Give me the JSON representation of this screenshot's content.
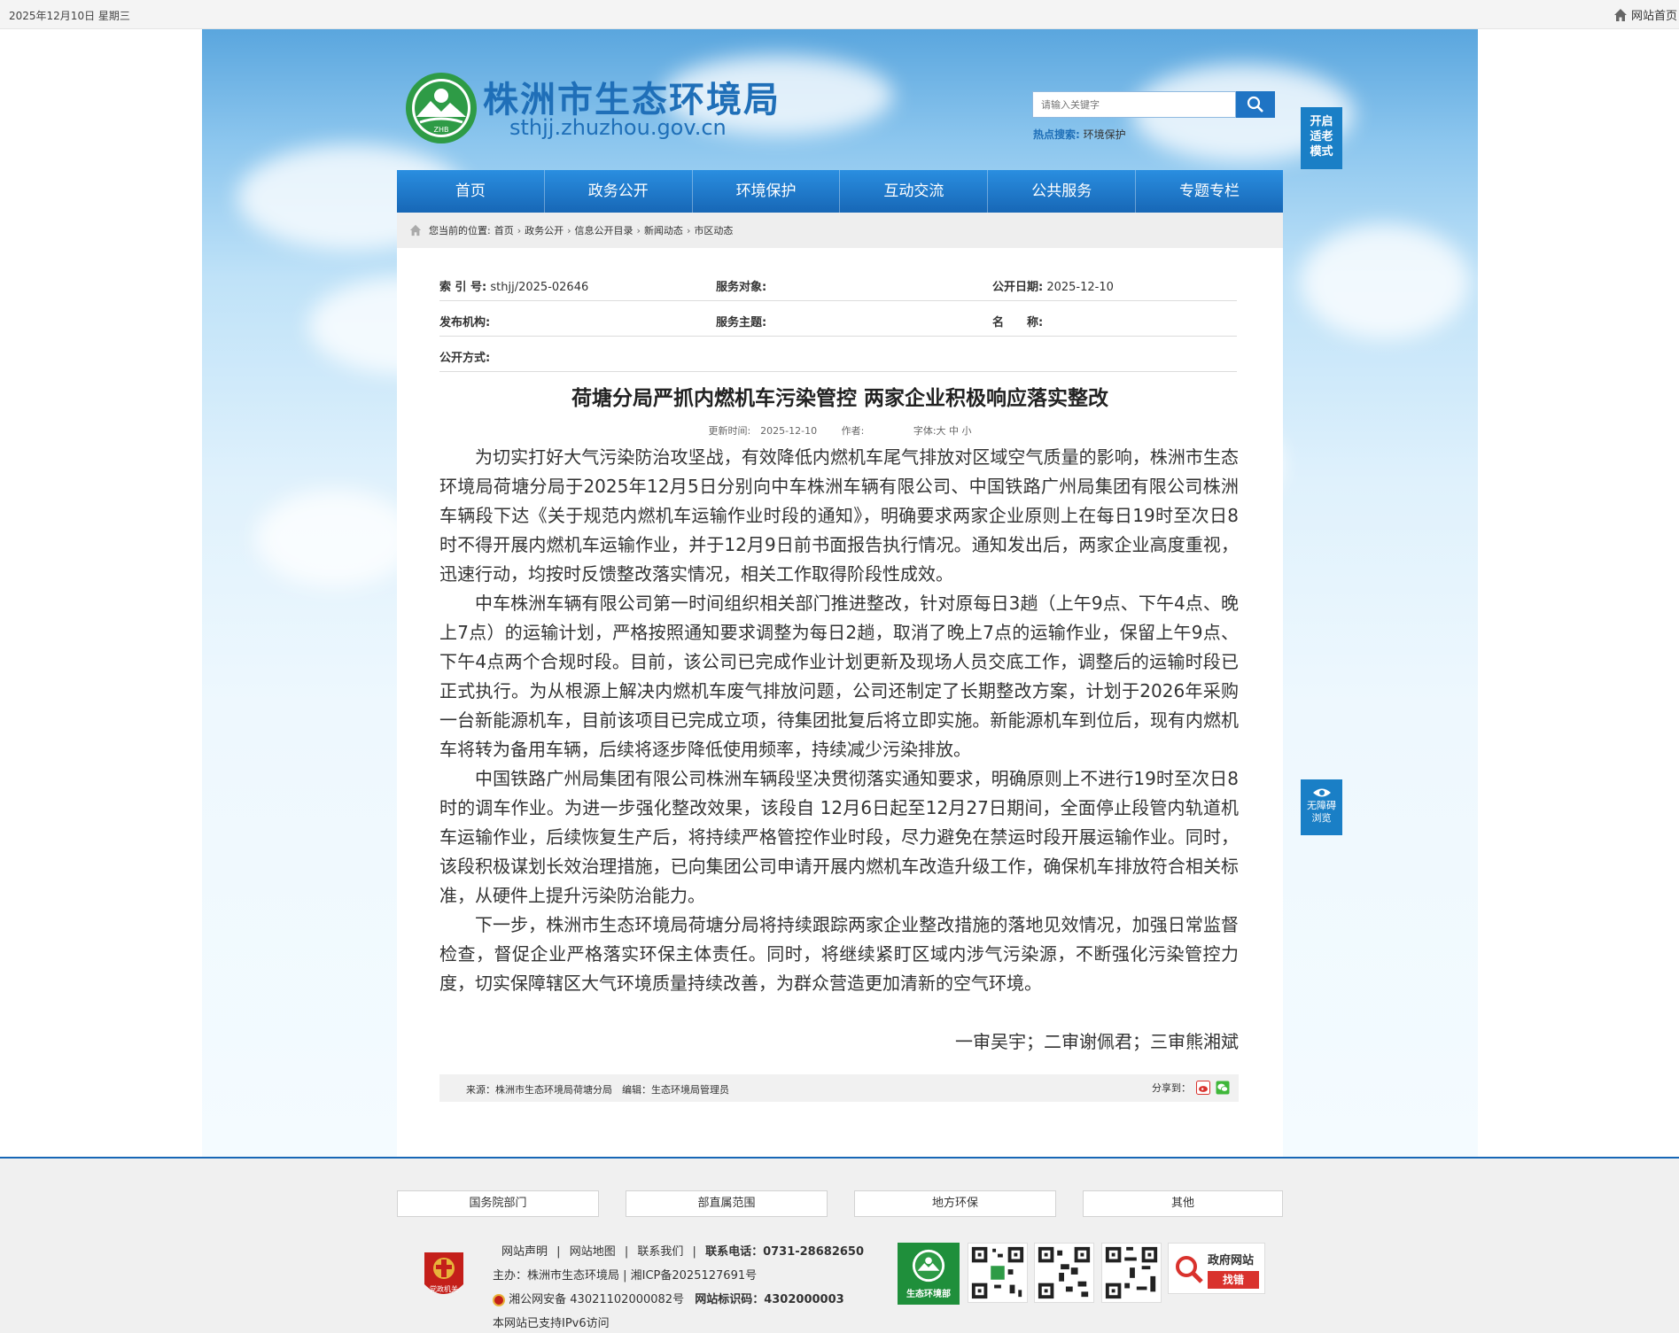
{
  "topbar": {
    "date": "2025年12月10日 星期三",
    "home_label": "网站首页"
  },
  "header": {
    "title": "株洲市生态环境局",
    "domain": "sthjj.zhuzhou.gov.cn",
    "logo_text": "ZHB",
    "search_placeholder": "请输入关键字",
    "hot_label": "热点搜索:",
    "hot_word": "环境保护",
    "elder_mode": [
      "开启",
      "适老",
      "模式"
    ],
    "accessibility": [
      "无障碍",
      "浏览"
    ]
  },
  "nav": [
    "首页",
    "政务公开",
    "环境保护",
    "互动交流",
    "公共服务",
    "专题专栏"
  ],
  "breadcrumb": {
    "prefix": "您当前的位置:",
    "items": [
      "首页",
      "政务公开",
      "信息公开目录",
      "新闻动态",
      "市区动态"
    ]
  },
  "meta": {
    "index_label": "索 引 号:",
    "index_value": "sthjj/2025-02646",
    "target_label": "服务对象:",
    "date_label": "公开日期:",
    "date_value": "2025-12-10",
    "org_label": "发布机构:",
    "topic_label": "服务主题:",
    "name_label": "名　　称:",
    "method_label": "公开方式:"
  },
  "article": {
    "title": "荷塘分局严抓内燃机车污染管控 两家企业积极响应落实整改",
    "updated": "更新时间:　2025-12-10",
    "author": "作者:",
    "fontsize": "字体:大 中 小",
    "paragraphs": [
      "为切实打好大气污染防治攻坚战，有效降低内燃机车尾气排放对区域空气质量的影响，株洲市生态环境局荷塘分局于2025年12月5日分别向中车株洲车辆有限公司、中国铁路广州局集团有限公司株洲车辆段下达《关于规范内燃机车运输作业时段的通知》，明确要求两家企业原则上在每日19时至次日8时不得开展内燃机车运输作业，并于12月9日前书面报告执行情况。通知发出后，两家企业高度重视，迅速行动，均按时反馈整改落实情况，相关工作取得阶段性成效。",
      "中车株洲车辆有限公司第一时间组织相关部门推进整改，针对原每日3趟（上午9点、下午4点、晚上7点）的运输计划，严格按照通知要求调整为每日2趟，取消了晚上7点的运输作业，保留上午9点、下午4点两个合规时段。目前，该公司已完成作业计划更新及现场人员交底工作，调整后的运输时段已正式执行。为从根源上解决内燃机车废气排放问题，公司还制定了长期整改方案，计划于2026年采购一台新能源机车，目前该项目已完成立项，待集团批复后将立即实施。新能源机车到位后，现有内燃机车将转为备用车辆，后续将逐步降低使用频率，持续减少污染排放。",
      "中国铁路广州局集团有限公司株洲车辆段坚决贯彻落实通知要求，明确原则上不进行19时至次日8时的调车作业。为进一步强化整改效果，该段自 12月6日起至12月27日期间，全面停止段管内轨道机车运输作业，后续恢复生产后，将持续严格管控作业时段，尽力避免在禁运时段开展运输作业。同时，该段积极谋划长效治理措施，已向集团公司申请开展内燃机车改造升级工作，确保机车排放符合相关标准，从硬件上提升污染防治能力。",
      "下一步，株洲市生态环境局荷塘分局将持续跟踪两家企业整改措施的落地见效情况，加强日常监督检查，督促企业严格落实环保主体责任。同时，将继续紧盯区域内涉气污染源，不断强化污染管控力度，切实保障辖区大气环境质量持续改善，为群众营造更加清新的空气环境。"
    ],
    "signature": "一审吴宇；二审谢佩君；三审熊湘斌",
    "source": "来源：株洲市生态环境局荷塘分局　编辑：生态环境局管理员",
    "share_label": "分享到："
  },
  "footer": {
    "links": [
      "国务院部门",
      "部直属范围",
      "地方环保",
      "其他"
    ],
    "nav_links": [
      "网站声明",
      "网站地图",
      "联系我们"
    ],
    "phone": "联系电话：0731-28682650",
    "host": "主办：株洲市生态环境局 | 湘ICP备2025127691号",
    "police": "湘公网安备 43021102000082号",
    "site_id": "网站标识码：4302000003",
    "ipv6": "本网站已支持IPv6访问",
    "badge_text": "党政机关",
    "zhb_text": "生态环境部",
    "jiucuo_top": "政府网站",
    "jiucuo_bottom": "找错"
  }
}
